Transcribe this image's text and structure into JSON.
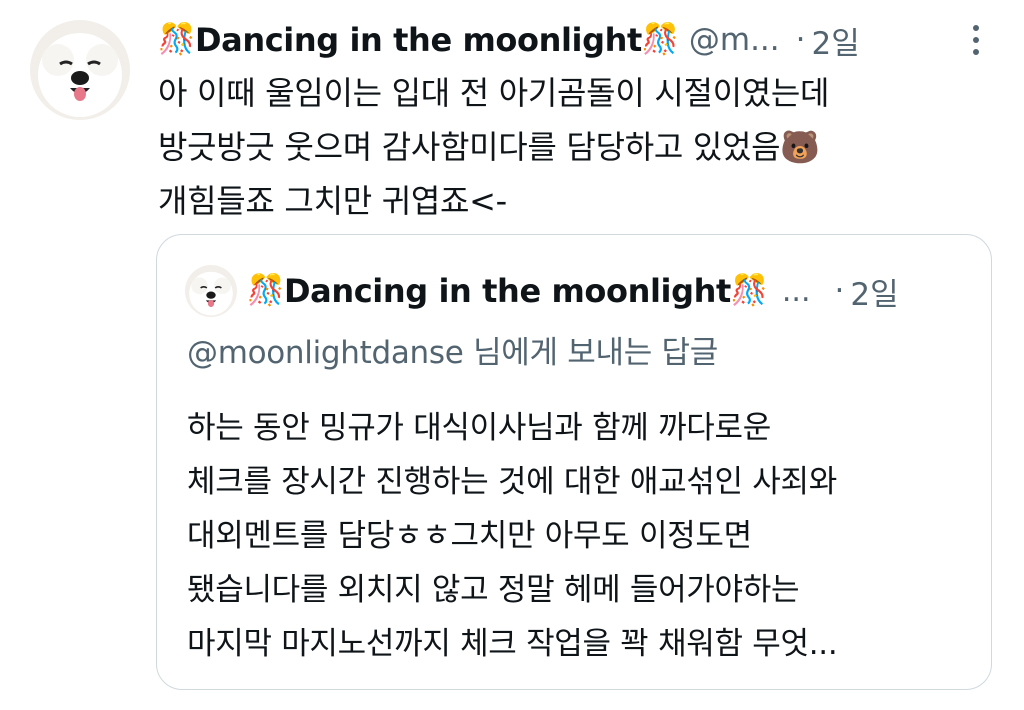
{
  "tweet": {
    "author_name": "Dancing in the moonlight",
    "name_emoji_left": "🎊",
    "name_emoji_right": "🎊",
    "handle": "@m...",
    "dot": "·",
    "time": "2일",
    "text_lines": [
      "아 이때 울임이는 입대 전 아기곰돌이 시절이였는데",
      "방긋방긋 웃으며 감사함미다를 담당하고 있었음🐻",
      "개힘들죠 그치만 귀엽죠<-"
    ],
    "avatar": "white-dog-avatar",
    "more_icon": "more-vertical-icon"
  },
  "quote": {
    "author_name": "Dancing in the moonlight",
    "name_emoji_left": "🎊",
    "name_emoji_right": "🎊",
    "handle": "...",
    "dot": "·",
    "time": "2일",
    "reply_to": "@moonlightdanse 님에게 보내는 답글",
    "text_lines": [
      "하는 동안 밍규가 대식이사님과 함께 까다로운",
      "체크를 장시간 진행하는 것에 대한 애교섞인 사죄와",
      "대외멘트를 담당ㅎㅎ그치만 아무도 이정도면",
      "됐습니다를 외치지 않고 정말 헤메 들어가야하는",
      "마지막 마지노선까지 체크 작업을 꽉 채워함 무엇..."
    ],
    "avatar": "white-dog-avatar"
  },
  "colors": {
    "text": "#0f1419",
    "secondary": "#536471",
    "border": "#cfd9de",
    "background": "#ffffff"
  }
}
